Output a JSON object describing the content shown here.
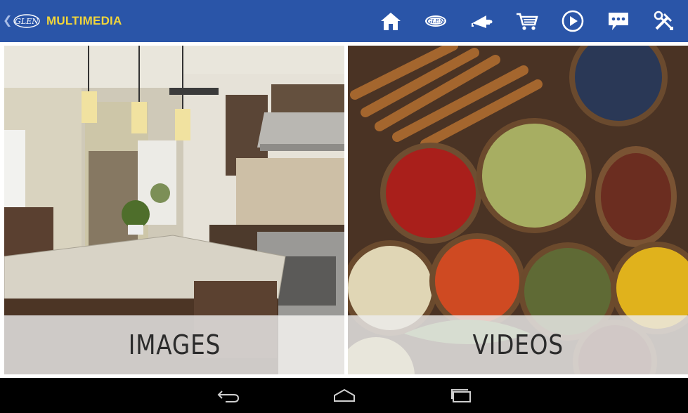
{
  "header": {
    "back_glyph": "❮",
    "logo_text": "GLEN",
    "title": "MULTIMEDIA",
    "nav_icons": [
      "home-icon",
      "glen-logo-icon",
      "megaphone-icon",
      "cart-icon",
      "play-icon",
      "chat-icon",
      "tools-icon"
    ]
  },
  "tiles": [
    {
      "label": "IMAGES"
    },
    {
      "label": "VIDEOS"
    }
  ],
  "system_nav": [
    "back-icon",
    "home-icon",
    "recents-icon"
  ],
  "colors": {
    "header_bg": "#2a55a8",
    "title": "#f1d53a",
    "system_bar": "#000000"
  }
}
